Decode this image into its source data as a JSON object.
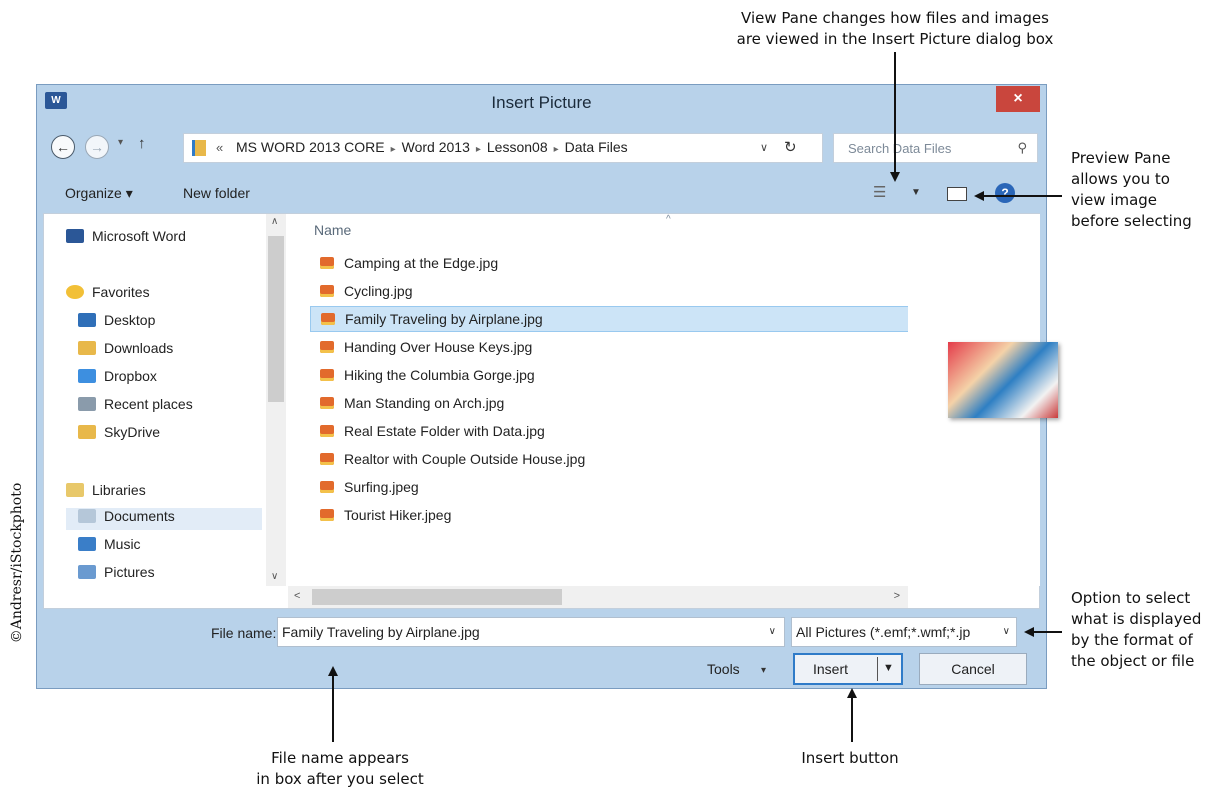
{
  "annotations": {
    "view_pane": [
      "View Pane changes how files and images",
      "are viewed in the Insert Picture dialog box"
    ],
    "preview_pane": [
      "Preview Pane",
      "allows you to",
      "view image",
      "before selecting"
    ],
    "option_select": [
      "Option to select",
      "what is displayed",
      "by the format of",
      "the object or file"
    ],
    "file_name": [
      "File name appears",
      "in box after you select"
    ],
    "insert_button": "Insert button",
    "credit": "©Andresr/iStockphoto"
  },
  "window": {
    "app_icon": "W",
    "title": "Insert Picture",
    "close_label": "×"
  },
  "address_bar": {
    "back_icon": "←",
    "forward_icon": "→",
    "up_icon": "↑",
    "prefix": "«",
    "crumbs": [
      "MS WORD 2013 CORE",
      "Word 2013",
      "Lesson08",
      "Data Files"
    ],
    "separator": "▸",
    "refresh_icon": "↻",
    "search_placeholder": "Search Data Files",
    "search_icon": "⚲"
  },
  "toolbar": {
    "organize": "Organize ▾",
    "new_folder": "New folder",
    "view_icon": "☰",
    "help_icon": "?"
  },
  "nav_pane": {
    "items": [
      {
        "label": "Microsoft Word",
        "icon": "word-icon",
        "color": "#2b5797"
      },
      {
        "label": "Favorites",
        "icon": "star-icon",
        "color": "#f2c037"
      },
      {
        "label": "Desktop",
        "icon": "desktop-icon",
        "color": "#2f6fb8"
      },
      {
        "label": "Downloads",
        "icon": "downloads-icon",
        "color": "#e8b84a"
      },
      {
        "label": "Dropbox",
        "icon": "dropbox-icon",
        "color": "#3d8fe0"
      },
      {
        "label": "Recent places",
        "icon": "recent-places-icon",
        "color": "#8a9bab"
      },
      {
        "label": "SkyDrive",
        "icon": "skydrive-icon",
        "color": "#e8b84a"
      },
      {
        "label": "Libraries",
        "icon": "libraries-icon",
        "color": "#e8c86a"
      },
      {
        "label": "Documents",
        "icon": "documents-icon",
        "color": "#b5c7d9"
      },
      {
        "label": "Music",
        "icon": "music-icon",
        "color": "#3a7ec8"
      },
      {
        "label": "Pictures",
        "icon": "pictures-icon",
        "color": "#6a9ad0"
      }
    ]
  },
  "file_list": {
    "column_header": "Name",
    "files": [
      "Camping at the Edge.jpg",
      "Cycling.jpg",
      "Family Traveling by Airplane.jpg",
      "Handing Over House Keys.jpg",
      "Hiking the Columbia Gorge.jpg",
      "Man Standing on Arch.jpg",
      "Real Estate Folder with Data.jpg",
      "Realtor with Couple Outside House.jpg",
      "Surfing.jpeg",
      "Tourist Hiker.jpeg"
    ],
    "selected_index": 2
  },
  "bottom": {
    "file_name_label": "File name:",
    "file_name_value": "Family Traveling by Airplane.jpg",
    "filter_value": "All Pictures (*.emf;*.wmf;*.jp",
    "tools_label": "Tools",
    "insert_label": "Insert",
    "cancel_label": "Cancel",
    "dropdown_icon": "▾"
  },
  "colors": {
    "dialog_frame": "#b8d2ea",
    "selection": "#cce4f7",
    "close_button": "#c9463d",
    "insert_border": "#2f7bc8"
  }
}
